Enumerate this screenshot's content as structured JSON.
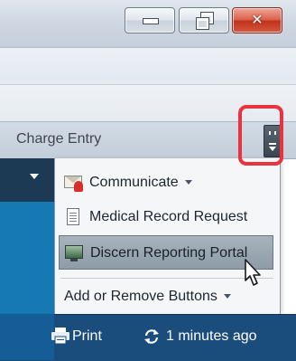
{
  "window_controls": {
    "minimize_icon": "minimize-icon",
    "restore_icon": "restore-icon",
    "close_glyph": "✕"
  },
  "toolbar": {
    "label": "Charge Entry",
    "overflow_glyph": "▸▸"
  },
  "menu": {
    "items": [
      {
        "label": "Communicate",
        "icon": "communicate-icon",
        "has_dropdown": true
      },
      {
        "label": "Medical Record Request",
        "icon": "document-icon",
        "has_dropdown": false
      },
      {
        "label": "Discern Reporting Portal",
        "icon": "monitor-icon",
        "has_dropdown": false,
        "highlighted": true
      }
    ],
    "footer_label": "Add or Remove Buttons"
  },
  "status_bar": {
    "print_label": "Print",
    "refresh_label": "1 minutes ago"
  },
  "colors": {
    "highlight_outline": "#ea3340",
    "status_bar": "#1a4c7c",
    "left_column": "#1679b3"
  }
}
